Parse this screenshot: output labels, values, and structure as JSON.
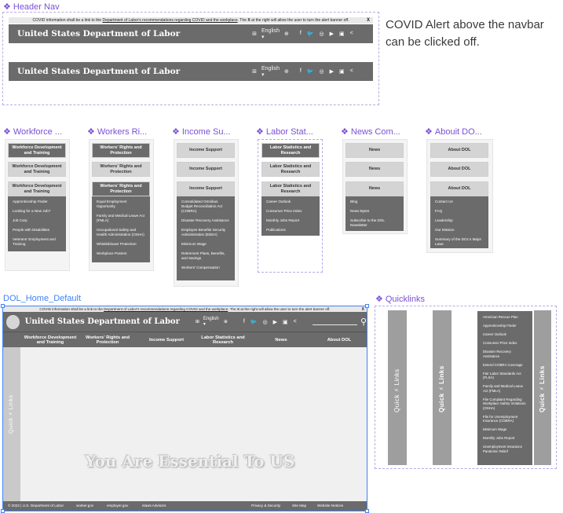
{
  "labels": {
    "header_nav": "Header Nav",
    "workforce": "Workforce ...",
    "workers": "Workers Ri...",
    "income": "Income Su...",
    "labor": "Labor Stat...",
    "news": "News Com...",
    "about": "Abouit DO...",
    "home": "DOL_Home_Default",
    "quicklinks": "Quicklinks"
  },
  "note": "COVID Alert above the navbar can be clicked off.",
  "alert": {
    "text_a": "COVID information shall be a link to the ",
    "link": "Department of Labor's recommendations regarding COVID and the workplace",
    "text_b": ". The ",
    "x_word": "X",
    "text_c": " at the right will allow the user to turn the alert banner off.",
    "close": "X"
  },
  "header": {
    "agency": "United States Department of Labor",
    "language": "English ▾",
    "social": [
      "f",
      "🐦",
      "◎",
      "▶",
      "▣",
      "<"
    ]
  },
  "columns": {
    "workforce": {
      "top": "Workforce Development and Training",
      "hover": "Workforce Development and Training",
      "open": "Workforce Development and Training",
      "items": [
        "Apprenticeship Finder",
        "Looking for a New Job?",
        "Job Corp",
        "People with Disabilities",
        "Veterans' Employment and Training"
      ]
    },
    "workers": {
      "top": "Workers' Rights and Protection",
      "hover": "Workers' Rights and Protection",
      "open": "Workers' Rights and Protection",
      "items": [
        "Equal Employment Opportunity",
        "Family and Medical Leave Act (FMLA)",
        "Occupational Safety and Health Administration (OSHA)",
        "Whistleblower Protection",
        "Workplace Posters"
      ]
    },
    "income": {
      "top": "Income Support",
      "hover": "Income Support",
      "open": "Income Support",
      "items": [
        "Consolidated Omnibus Budget Reconciliation Act (COBRA)",
        "Disaster Recovery Assistance",
        "Employee Benefits Security Administration (EBSA)",
        "Minimum Wage",
        "Retirement Plans, Benefits, and Savings",
        "Workers' Compensation"
      ]
    },
    "labor": {
      "top": "Labor Statistics and Research",
      "hover": "Labor Statistics and Research",
      "open": "Labor Statistics and Research",
      "items": [
        "Career Outlook",
        "Consumer Price Index",
        "Monthly Jobs Report",
        "Publications"
      ]
    },
    "news": {
      "top": "News",
      "hover": "News",
      "open": "News",
      "items": [
        "Blog",
        "News Bytes",
        "Subscribe to the DOL Newsletter"
      ]
    },
    "about": {
      "top": "About DOL",
      "hover": "About DOL",
      "open": "About DOL",
      "items": [
        "Contact Us",
        "FAQ",
        "Leadership",
        "Our Mission",
        "Summary of the DOL's Major Laws"
      ]
    }
  },
  "home": {
    "nav": [
      "Workforce Development and Training",
      "Workers' Rights and Protection",
      "Income Support",
      "Labor Statistics and Research",
      "News",
      "About DOL"
    ],
    "quick_links": "Quick ⚡ Links",
    "tagline": "You Are Essential To US",
    "footer": {
      "copyright": "© 2022 | U.S. Department of Labor",
      "worker": "worker.gov",
      "employer": "employer.gov",
      "advisors": "elaws Advisors",
      "privacy": "Privacy & Security",
      "sitemap": "Site Map",
      "notices": "Website Notices"
    }
  },
  "quicklinks": {
    "bar_label_a": "Quick ⚡ Links",
    "bar_label_b": "Quick ⚡ Links",
    "bar_label_c": "Quick ⚡ Links",
    "items": [
      "American Rescue Plan",
      "Apprenticeship Finder",
      "Career Outlook",
      "Consumer Price Index",
      "Disaster Recovery Assistance",
      "Extend COBRA Coverage",
      "Fair Labor Standards Act (FLSA)",
      "Family and Medical Leave Act (FMLA)",
      "File Complaint Regarding Workplace Safety Violations (OSHA)",
      "File for Unemployment Insurance (COBRA)",
      "Minimum Wage",
      "Monthly Jobs Report",
      "Unemployment Insurance Pandemic Relief"
    ]
  },
  "colors": {
    "nav": "#6b6b6b",
    "label": "#7b4fd6",
    "selection": "#3f83f8"
  }
}
